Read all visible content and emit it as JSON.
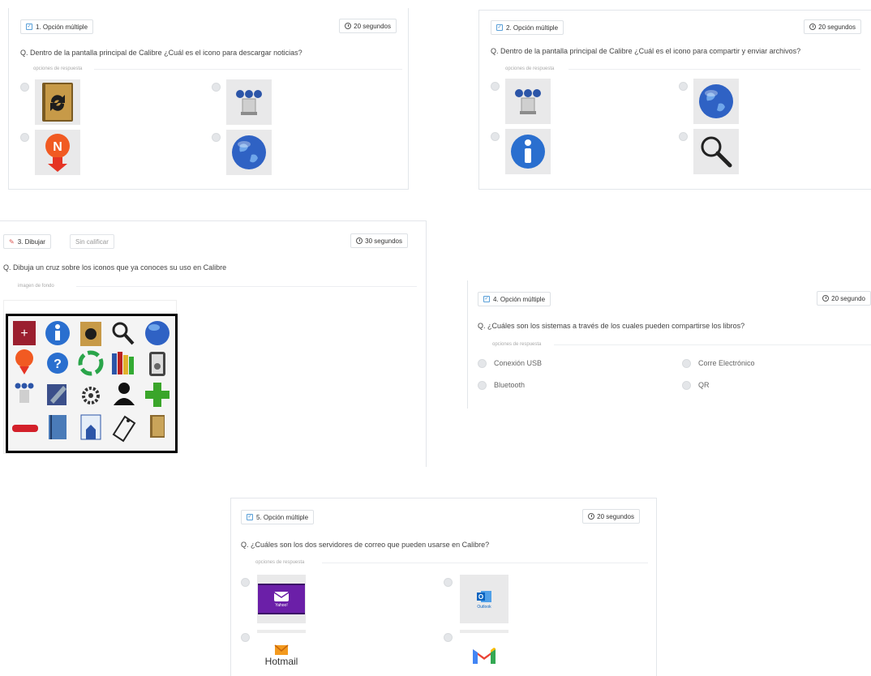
{
  "q1": {
    "type": "1. Opción múltiple",
    "time": "20 segundos",
    "question": "Q. Dentro de la pantalla principal de Calibre ¿Cuál es el icono para descargar noticias?",
    "section": "opciones de respuesta",
    "options": [
      {
        "icon": "convert-book-icon"
      },
      {
        "icon": "connect-share-icon"
      },
      {
        "icon": "fetch-news-icon"
      },
      {
        "icon": "globe-icon"
      }
    ]
  },
  "q2": {
    "type": "2. Opción múltiple",
    "time": "20 segundos",
    "question": "Q. Dentro de la pantalla principal de Calibre ¿Cuál es el icono para compartir y enviar archivos?",
    "section": "opciones de respuesta",
    "options": [
      {
        "icon": "connect-share-icon"
      },
      {
        "icon": "globe-icon"
      },
      {
        "icon": "info-icon"
      },
      {
        "icon": "search-icon"
      }
    ]
  },
  "q3": {
    "type": "3. Dibujar",
    "ungraded": "Sin calificar",
    "time": "30 segundos",
    "question": "Q. Dibuja un cruz sobre los iconos que ya conoces su uso en Calibre",
    "section": "imagen de fondo"
  },
  "q4": {
    "type": "4. Opción múltiple",
    "time": "20 segundo",
    "question": "Q. ¿Cuáles son los sistemas a través de los cuales pueden compartirse los libros?",
    "section": "opciones de respuesta",
    "options": [
      "Conexión USB",
      "Corre Electrónico",
      "Bluetooth",
      "QR"
    ]
  },
  "q5": {
    "type": "5. Opción múltiple",
    "time": "20 segundos",
    "question": "Q. ¿Cuáles son los dos servidores de correo que pueden usarse en Calibre?",
    "section": "opciones de respuesta",
    "options": [
      {
        "icon": "yahoo-mail-icon",
        "text": "Yahoo!"
      },
      {
        "icon": "outlook-icon",
        "text": "Outlook"
      },
      {
        "icon": "hotmail-icon",
        "text": "Hotmail"
      },
      {
        "icon": "gmail-icon"
      }
    ]
  },
  "colors": {
    "accent": "#3a86c8",
    "radio": "#e4e6e9",
    "border": "#dde1e5"
  }
}
